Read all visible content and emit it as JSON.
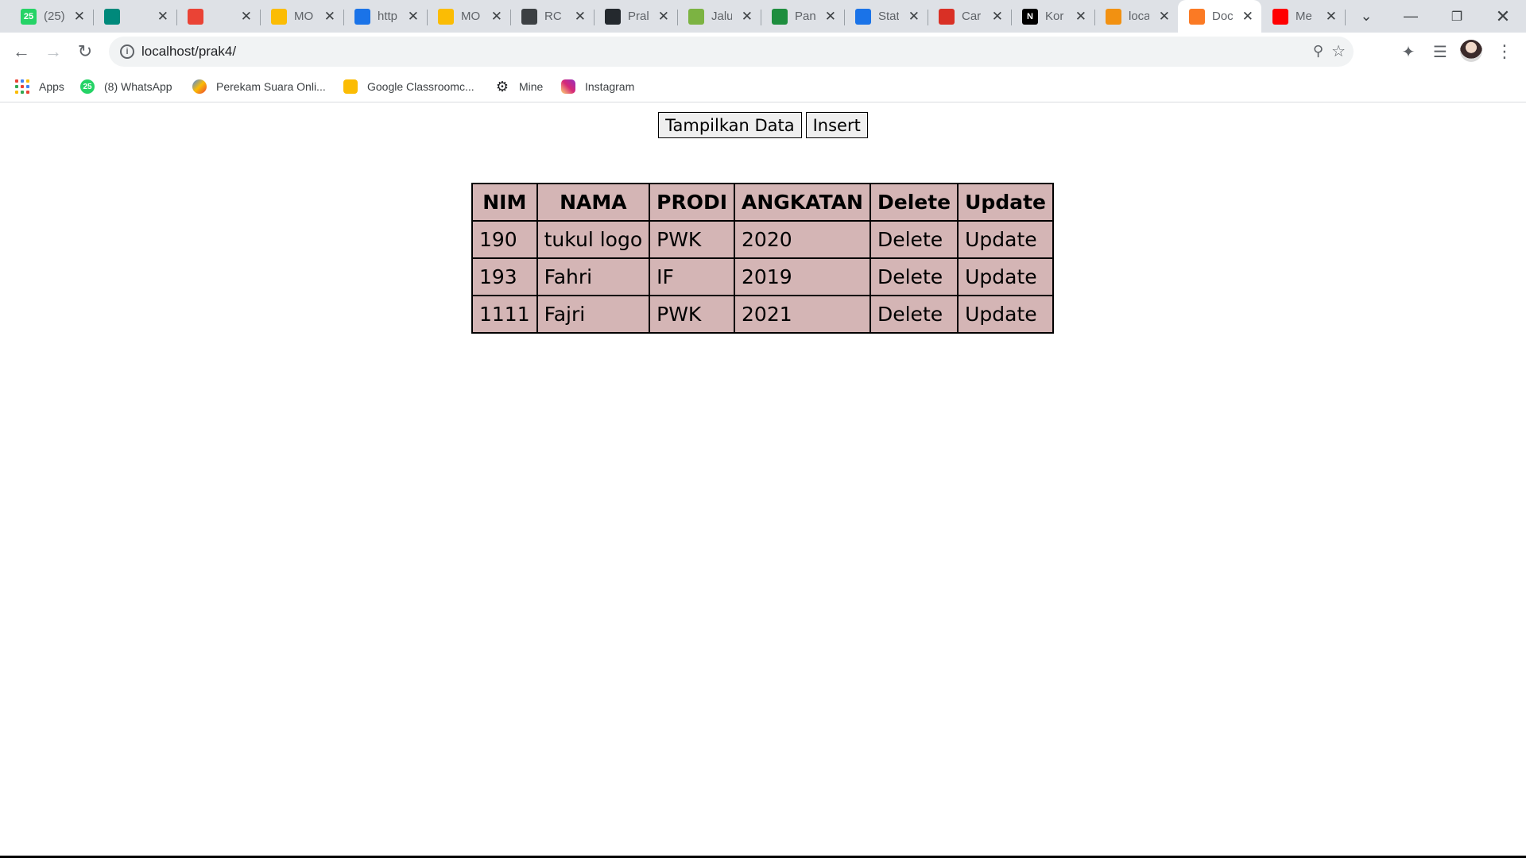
{
  "browser": {
    "tabs": [
      {
        "favicon": "whatsapp-icon",
        "favicon_color": "#25d366",
        "favicon_text": "25",
        "title": "(25)"
      },
      {
        "favicon": "meet-icon",
        "favicon_color": "#00897b",
        "favicon_text": "",
        "title": ""
      },
      {
        "favicon": "record-icon",
        "favicon_color": "#ea4335",
        "favicon_text": "",
        "title": ""
      },
      {
        "favicon": "drive-icon",
        "favicon_color": "#fbbc04",
        "favicon_text": "",
        "title": "MO"
      },
      {
        "favicon": "moon-icon",
        "favicon_color": "#1a73e8",
        "favicon_text": "",
        "title": "http"
      },
      {
        "favicon": "drive-icon",
        "favicon_color": "#fbbc04",
        "favicon_text": "",
        "title": "MO"
      },
      {
        "favicon": "contact-icon",
        "favicon_color": "#3c4043",
        "favicon_text": "",
        "title": "RC"
      },
      {
        "favicon": "github-icon",
        "favicon_color": "#24292e",
        "favicon_text": "",
        "title": "Pral"
      },
      {
        "favicon": "map-icon",
        "favicon_color": "#7cb342",
        "favicon_text": "",
        "title": "Jalu"
      },
      {
        "favicon": "signal-icon",
        "favicon_color": "#1e8e3e",
        "favicon_text": "",
        "title": "Pan"
      },
      {
        "favicon": "diamond-icon",
        "favicon_color": "#1a73e8",
        "favicon_text": "",
        "title": "Stat"
      },
      {
        "favicon": "chart-icon",
        "favicon_color": "#d93025",
        "favicon_text": "",
        "title": "Car"
      },
      {
        "favicon": "notion-icon",
        "favicon_color": "#000000",
        "favicon_text": "N",
        "title": "Kor"
      },
      {
        "favicon": "pma-icon",
        "favicon_color": "#f29111",
        "favicon_text": "",
        "title": "loca"
      },
      {
        "favicon": "xampp-icon",
        "favicon_color": "#fb7a24",
        "favicon_text": "",
        "title": "Doc"
      },
      {
        "favicon": "youtube-icon",
        "favicon_color": "#ff0000",
        "favicon_text": "",
        "title": "Me"
      }
    ],
    "active_tab_index": 14,
    "address": "localhost/prak4/",
    "bookmarks": [
      {
        "icon": "apps-icon",
        "label": "Apps"
      },
      {
        "icon": "whatsapp-icon",
        "label": "(8) WhatsApp"
      },
      {
        "icon": "recorder-icon",
        "label": "Perekam Suara Onli..."
      },
      {
        "icon": "classroom-icon",
        "label": "Google Classroomc..."
      },
      {
        "icon": "gear-icon",
        "label": "Mine"
      },
      {
        "icon": "instagram-icon",
        "label": "Instagram"
      }
    ]
  },
  "page": {
    "buttons": {
      "show": "Tampilkan Data",
      "insert": "Insert"
    },
    "table": {
      "headers": [
        "NIM",
        "NAMA",
        "PRODI",
        "ANGKATAN",
        "Delete",
        "Update"
      ],
      "rows": [
        {
          "nim": "190",
          "nama": "tukul logo",
          "prodi": "PWK",
          "angkatan": "2020",
          "delete": "Delete",
          "update": "Update"
        },
        {
          "nim": "193",
          "nama": "Fahri",
          "prodi": "IF",
          "angkatan": "2019",
          "delete": "Delete",
          "update": "Update"
        },
        {
          "nim": "1111",
          "nama": "Fajri",
          "prodi": "PWK",
          "angkatan": "2021",
          "delete": "Delete",
          "update": "Update"
        }
      ]
    },
    "colors": {
      "table_bg": "#d4b5b5",
      "button_bg": "#efefef"
    }
  }
}
